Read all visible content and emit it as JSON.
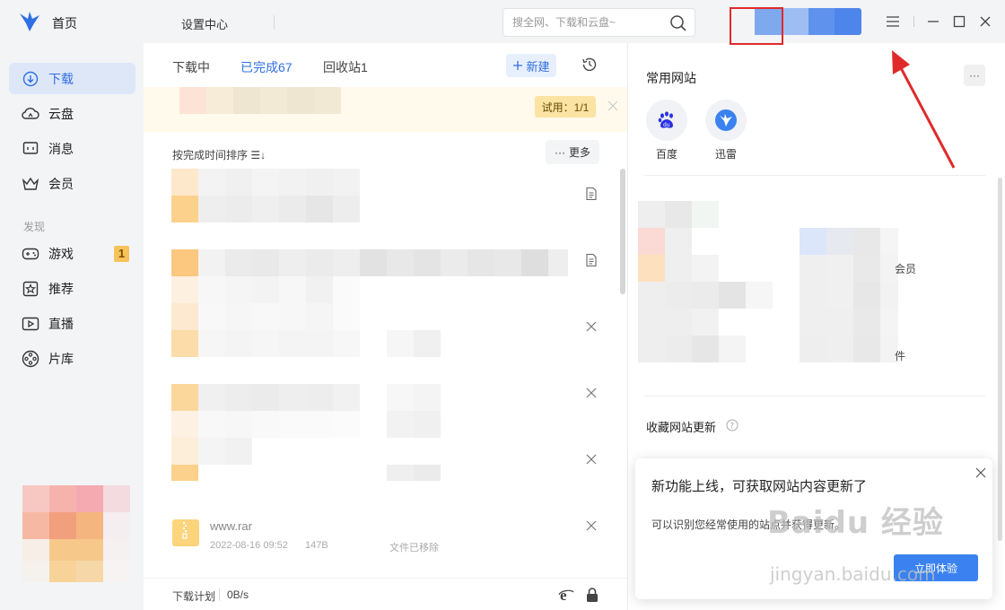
{
  "sidebar": {
    "home_label": "首页",
    "items": [
      {
        "label": "下载",
        "icon": "download-icon"
      },
      {
        "label": "云盘",
        "icon": "cloud-icon"
      },
      {
        "label": "消息",
        "icon": "message-icon"
      },
      {
        "label": "会员",
        "icon": "crown-icon"
      }
    ],
    "section_label": "发现",
    "discover_items": [
      {
        "label": "游戏",
        "icon": "gamepad-icon"
      },
      {
        "label": "推荐",
        "icon": "star-icon"
      },
      {
        "label": "直播",
        "icon": "live-icon"
      },
      {
        "label": "片库",
        "icon": "film-reel-icon"
      }
    ],
    "game_badge": "1",
    "active_color": "#2f6fe4"
  },
  "titlebar": {
    "settings_label": "设置中心",
    "search_placeholder": "搜全网、下载和云盘~"
  },
  "download": {
    "tabs": [
      {
        "label": "下载中"
      },
      {
        "label": "已完成67"
      },
      {
        "label": "回收站1"
      }
    ],
    "new_label": "新建",
    "trial_label": "试用：1/1",
    "sort_label": "按完成时间排序 ☰↓",
    "more_label": "更多",
    "last_item": {
      "name": "www.rar",
      "date": "2022-08-16 09:52",
      "size": "147B",
      "status": "文件已移除"
    },
    "footer_label": "下载计划",
    "footer_speed": "0B/s"
  },
  "right_panel": {
    "title": "常用网站",
    "more": "···",
    "sites": [
      {
        "label": "百度",
        "icon": "baidu-icon"
      },
      {
        "label": "迅雷",
        "icon": "xunlei-icon"
      }
    ],
    "blur_text_a": "会员",
    "blur_text_b": "件",
    "collect_label": "收藏网站更新"
  },
  "popup": {
    "title": "新功能上线，可获取网站内容更新了",
    "desc": "可以识别您经常使用的站点并获得更新。",
    "button": "立即体验"
  },
  "watermark": {
    "main": "Baidu 经验",
    "sub": "jingyan.baidu.com"
  },
  "annotation": {
    "highlight_color": "#e02a2a"
  }
}
